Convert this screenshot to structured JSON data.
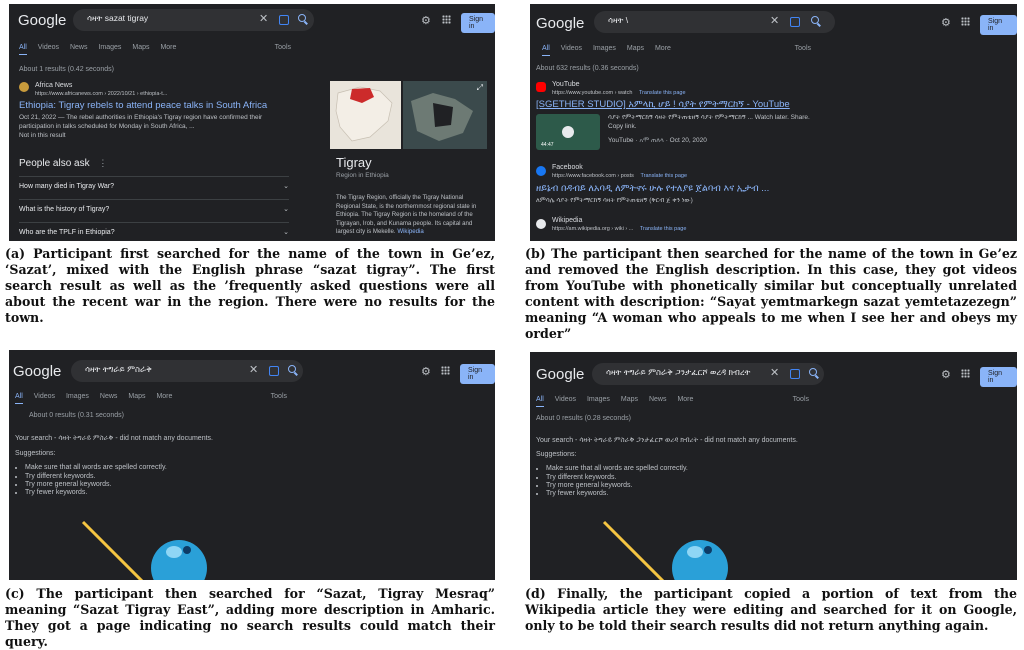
{
  "google": {
    "logo": "Google",
    "sign_in": "Sign in",
    "tools": "Tools"
  },
  "a": {
    "query": "ሳዛት sazat tigray",
    "tabs": [
      "All",
      "Videos",
      "News",
      "Images",
      "Maps",
      "More"
    ],
    "stats": "About 1 results (0.42 seconds)",
    "result": {
      "site": "Africa News",
      "url": "https://www.africanews.com › 2022/10/21 › ethiopia-t...",
      "title": "Ethiopia: Tigray rebels to attend peace talks in South Africa",
      "snippet1": "Oct 21, 2022 — The rebel authorities in Ethiopia's Tigray region have confirmed their",
      "snippet2": "participation in talks scheduled for Monday in South Africa, ...",
      "missing": "Not in this result"
    },
    "paa_title": "People also ask",
    "paa": [
      "How many died in Tigray War?",
      "What is the history of Tigray?",
      "Who are the TPLF in Ethiopia?"
    ],
    "kp": {
      "title": "Tigray",
      "subtitle": "Region in Ethiopia",
      "desc": "The Tigray Region, officially the Tigray National Regional State, is the northernmost regional state in Ethiopia. The Tigray Region is the homeland of the Tigrayan, Irob, and Kunama people. Its capital and largest city is Mekelle.",
      "wiki": "Wikipedia"
    },
    "caption": "(a) Participant first searched for the name of the town in Ge’ez, ‘Sazat’, mixed with the English phrase “sazat tigray”. The first search result as well as the ’frequently asked questions were all about the recent war in the region. There were no results for the town."
  },
  "b": {
    "query": "ሳዛት \\",
    "tabs": [
      "All",
      "Videos",
      "Images",
      "Maps",
      "More"
    ],
    "stats": "About 632 results (0.36 seconds)",
    "yt": {
      "site": "YouTube",
      "url": "https://www.youtube.com › watch",
      "translate": "Translate this page",
      "title": "[SGETHER STUDIO] አምላኪ ሆይ ! ሳያት የምትማርከኝ - YouTube",
      "snippet1": "ሳያት የምትማርከኝ ሳዛት የምትጠቴዘኝ ሳያት የምትማርከኝ ... Watch later. Share.",
      "snippet2": "Copy link.",
      "source": "YouTube",
      "channel": "አሞ ጠለላ",
      "date": "Oct 20, 2020",
      "duration": "44:47"
    },
    "fb": {
      "site": "Facebook",
      "url": "https://www.facebook.com › posts",
      "translate": "Translate this page",
      "title": "ዘይኔብ በዳብይ ለአባዲ ለምትኖሩ ሁሉ የተለያዩ ጀልባብ እና ኢታብ ...",
      "snippet": "ለምሳሌ ሳያት የምትማርከኝ ሳዛት የምትጠቴዘኝ (ቅርብ ጀ ቀን ነው)"
    },
    "wiki": {
      "site": "Wikipedia",
      "url": "https://am.wikipedia.org › wiki › ...",
      "translate": "Translate this page"
    },
    "caption": "(b) The participant then searched for the name of the town in Ge’ez and removed the English description. In this case, they got videos from YouTube with phonetically similar but conceptually unrelated content with description: “Sayat yemtmarkegn sazat yemtetazezegn” meaning “A woman who appeals to me when I see her and obeys my order”"
  },
  "c": {
    "query": "ሳዛት ትግራይ ምስራቅ",
    "tabs": [
      "All",
      "Videos",
      "Images",
      "News",
      "Maps",
      "More"
    ],
    "stats": "About 0 results (0.31 seconds)",
    "nomatch": "Your search - ሳዛት ትግራይ ምስራቅ - did not match any documents.",
    "suggestions": "Suggestions:",
    "tips": [
      "Make sure that all words are spelled correctly.",
      "Try different keywords.",
      "Try more general keywords.",
      "Try fewer keywords."
    ],
    "caption": "(c) The participant then searched for “Sazat, Tigray Mesraq” meaning “Sazat Tigray East”, adding more description in Amharic. They got a page indicating no search results could match their query."
  },
  "d": {
    "query": "ሳዛት ትግራይ ምስራቅ ጋንታፈርሾ ወረዳ ክብረት",
    "tabs": [
      "All",
      "Videos",
      "Images",
      "Maps",
      "News",
      "More"
    ],
    "stats": "About 0 results (0.28 seconds)",
    "nomatch": "Your search - ሳዛት ትግራይ ምስራቅ ጋንታፈርሾ ወረዳ ክብረት - did not match any documents.",
    "suggestions": "Suggestions:",
    "tips": [
      "Make sure that all words are spelled correctly.",
      "Try different keywords.",
      "Try more general keywords.",
      "Try fewer keywords."
    ],
    "caption": "(d) Finally, the participant copied a portion of text from the Wikipedia article they were editing and searched for it on Google, only to be told their search results did not return anything again."
  }
}
